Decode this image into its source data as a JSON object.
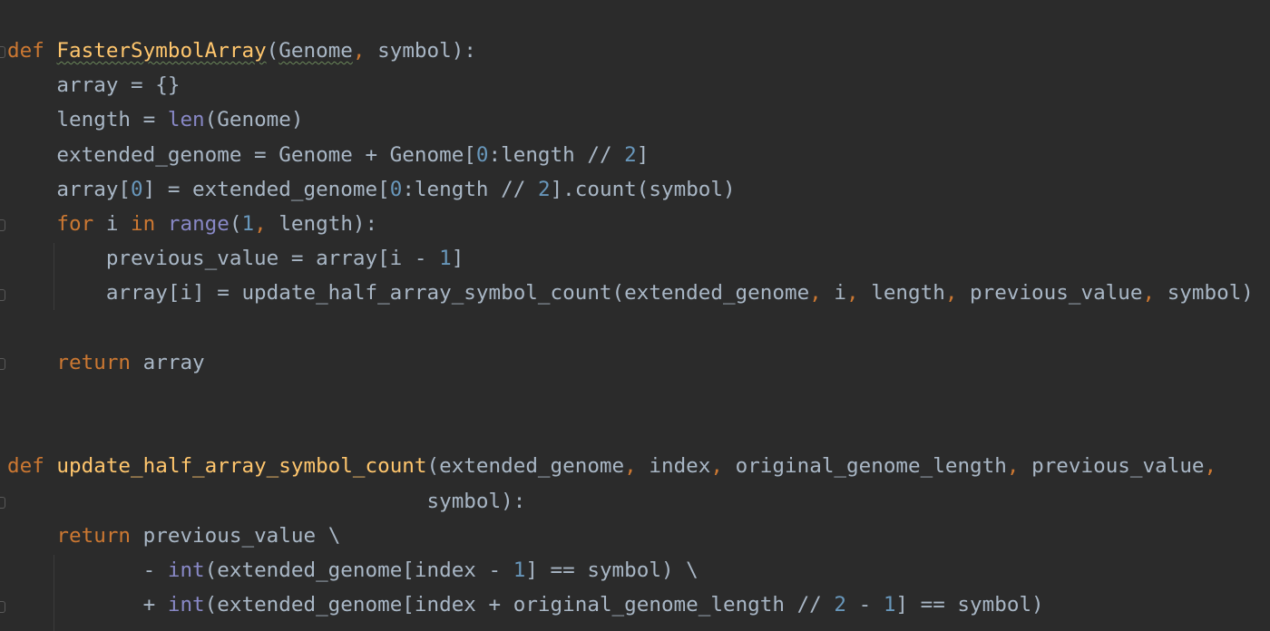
{
  "code_lines": [
    {
      "tokens": [
        {
          "t": "def",
          "c": "kw"
        },
        {
          "t": " "
        },
        {
          "t": "FasterSymbolArray",
          "c": "fn wavy"
        },
        {
          "t": "("
        },
        {
          "t": "Genome",
          "c": "wavy"
        },
        {
          "t": ",",
          "c": "punct"
        },
        {
          "t": " symbol):"
        }
      ]
    },
    {
      "tokens": [
        {
          "t": "    array = {}"
        }
      ]
    },
    {
      "tokens": [
        {
          "t": "    length = "
        },
        {
          "t": "len",
          "c": "bi"
        },
        {
          "t": "(Genome)"
        }
      ]
    },
    {
      "tokens": [
        {
          "t": "    extended_genome = Genome + Genome["
        },
        {
          "t": "0",
          "c": "num"
        },
        {
          "t": ":length // "
        },
        {
          "t": "2",
          "c": "num"
        },
        {
          "t": "]"
        }
      ]
    },
    {
      "tokens": [
        {
          "t": "    array["
        },
        {
          "t": "0",
          "c": "num"
        },
        {
          "t": "] = extended_genome["
        },
        {
          "t": "0",
          "c": "num"
        },
        {
          "t": ":length // "
        },
        {
          "t": "2",
          "c": "num"
        },
        {
          "t": "].count(symbol)"
        }
      ]
    },
    {
      "tokens": [
        {
          "t": "    "
        },
        {
          "t": "for",
          "c": "kw"
        },
        {
          "t": " i "
        },
        {
          "t": "in",
          "c": "kw"
        },
        {
          "t": " "
        },
        {
          "t": "range",
          "c": "bi"
        },
        {
          "t": "("
        },
        {
          "t": "1",
          "c": "num"
        },
        {
          "t": ",",
          "c": "punct"
        },
        {
          "t": " length):"
        }
      ]
    },
    {
      "tokens": [
        {
          "t": "        previous_value = array[i - "
        },
        {
          "t": "1",
          "c": "num"
        },
        {
          "t": "]"
        }
      ]
    },
    {
      "tokens": [
        {
          "t": "        array[i] = update_half_array_symbol_count(extended_genome"
        },
        {
          "t": ",",
          "c": "punct"
        },
        {
          "t": " i"
        },
        {
          "t": ",",
          "c": "punct"
        },
        {
          "t": " length"
        },
        {
          "t": ",",
          "c": "punct"
        },
        {
          "t": " previous_value"
        },
        {
          "t": ",",
          "c": "punct"
        },
        {
          "t": " symbol)"
        }
      ]
    },
    {
      "tokens": [
        {
          "t": ""
        }
      ]
    },
    {
      "tokens": [
        {
          "t": "    "
        },
        {
          "t": "return",
          "c": "kw"
        },
        {
          "t": " array"
        }
      ]
    },
    {
      "tokens": [
        {
          "t": ""
        }
      ]
    },
    {
      "tokens": [
        {
          "t": ""
        }
      ]
    },
    {
      "tokens": [
        {
          "t": "def",
          "c": "kw"
        },
        {
          "t": " "
        },
        {
          "t": "update_half_array_symbol_count",
          "c": "fn"
        },
        {
          "t": "(extended_genome"
        },
        {
          "t": ",",
          "c": "punct"
        },
        {
          "t": " index"
        },
        {
          "t": ",",
          "c": "punct"
        },
        {
          "t": " original_genome_length"
        },
        {
          "t": ",",
          "c": "punct"
        },
        {
          "t": " previous_value"
        },
        {
          "t": ",",
          "c": "punct"
        }
      ]
    },
    {
      "tokens": [
        {
          "t": "                                  symbol):"
        }
      ]
    },
    {
      "tokens": [
        {
          "t": "    "
        },
        {
          "t": "return",
          "c": "kw"
        },
        {
          "t": " previous_value \\"
        }
      ]
    },
    {
      "tokens": [
        {
          "t": "           - "
        },
        {
          "t": "int",
          "c": "bi"
        },
        {
          "t": "(extended_genome[index - "
        },
        {
          "t": "1",
          "c": "num"
        },
        {
          "t": "] == symbol) \\"
        }
      ]
    },
    {
      "tokens": [
        {
          "t": "           + "
        },
        {
          "t": "int",
          "c": "bi"
        },
        {
          "t": "(extended_genome[index + original_genome_length // "
        },
        {
          "t": "2",
          "c": "num"
        },
        {
          "t": " - "
        },
        {
          "t": "1",
          "c": "num"
        },
        {
          "t": "] == symbol)"
        }
      ]
    }
  ],
  "colors": {
    "background": "#2b2b2b",
    "default_text": "#a9b7c6",
    "keyword": "#cc7832",
    "function_name": "#ffc66d",
    "builtin": "#8888c6",
    "number": "#6897bb"
  }
}
